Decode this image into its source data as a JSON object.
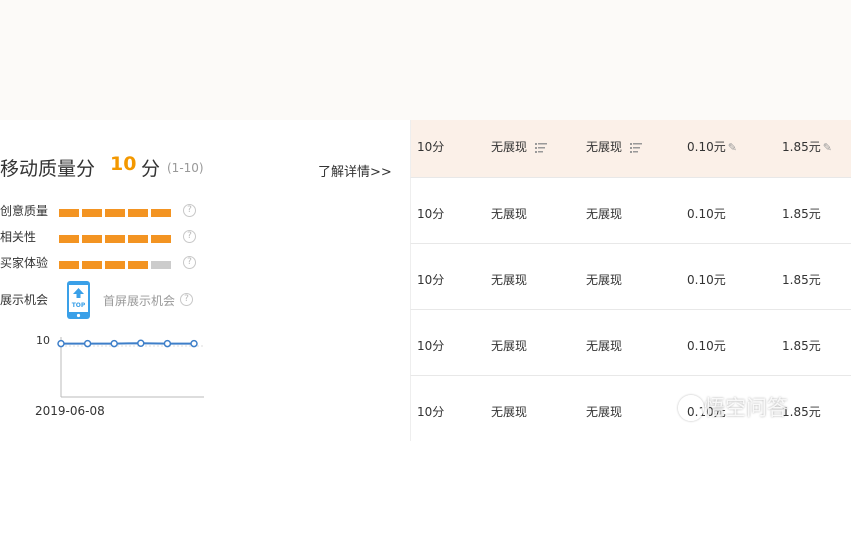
{
  "quality": {
    "title": "移动质量分",
    "score": "10",
    "unit": "分",
    "range": "(1-10)",
    "learn_more": "了解详情>>",
    "metrics": [
      {
        "label": "创意质量",
        "filled": 5,
        "total": 5
      },
      {
        "label": "相关性",
        "filled": 5,
        "total": 5
      },
      {
        "label": "买家体验",
        "filled": 4,
        "total": 5
      }
    ],
    "display_label": "展示机会",
    "top_label": "首屏展示机会",
    "phone_badge": "TOP",
    "help_glyph": "?"
  },
  "mini_chart": {
    "type": "line",
    "y_tick": "10",
    "x_label": "2019-06-08",
    "values": [
      9.4,
      9.4,
      9.4,
      9.9,
      9.4,
      9.4
    ]
  },
  "table": {
    "rows": [
      [
        "10分",
        "无展现",
        "无展现",
        "0.10元",
        "1.85元"
      ],
      [
        "10分",
        "无展现",
        "无展现",
        "0.10元",
        "1.85元"
      ],
      [
        "10分",
        "无展现",
        "无展现",
        "0.10元",
        "1.85元"
      ],
      [
        "10分",
        "无展现",
        "无展现",
        "0.10元",
        "1.85元"
      ],
      [
        "10分",
        "无展现",
        "无展现",
        "0.10元",
        "1.85元"
      ]
    ]
  },
  "watermark": "悟空问答",
  "colors": {
    "accent": "#f39800",
    "bar": "#f39422",
    "phone": "#3aa0e8",
    "line": "#3e7fc9",
    "header_bg": "#fbf0e8"
  }
}
